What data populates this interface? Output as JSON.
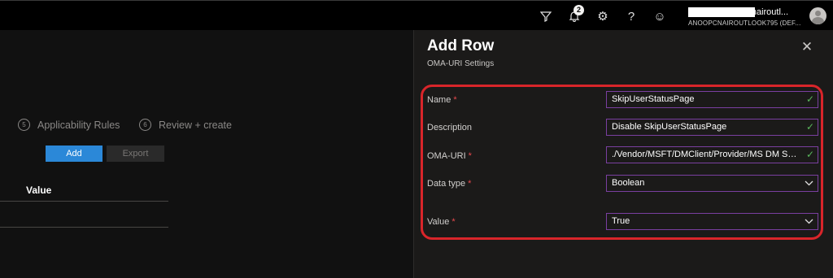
{
  "topbar": {
    "icons": [
      "filter-icon",
      "bell-icon",
      "gear-icon",
      "help-icon",
      "smiley-icon"
    ],
    "notification_count": "2",
    "user_email": "anoop@anoopcnairoutl...",
    "user_tenant": "ANOOPCNAIROUTLOOK795 (DEF..."
  },
  "wizard": {
    "steps": [
      {
        "number": "5",
        "label": "Applicability Rules"
      },
      {
        "number": "6",
        "label": "Review + create"
      }
    ],
    "add_label": "Add",
    "export_label": "Export",
    "column_header": "Value"
  },
  "panel": {
    "title": "Add Row",
    "subtitle": "OMA-URI Settings",
    "fields": [
      {
        "label": "Name",
        "required": true,
        "value": "SkipUserStatusPage",
        "state": "valid"
      },
      {
        "label": "Description",
        "required": false,
        "value": "Disable SkipUserStatusPage",
        "state": "valid"
      },
      {
        "label": "OMA-URI",
        "required": true,
        "value": "./Vendor/MSFT/DMClient/Provider/MS DM Server/FirstSyncStatus/SkipUserStatusPage",
        "state": "valid"
      },
      {
        "label": "Data type",
        "required": true,
        "value": "Boolean",
        "state": "dropdown"
      },
      {
        "label": "Value",
        "required": true,
        "value": "True",
        "state": "dropdown"
      }
    ],
    "required_marker": "*"
  },
  "colors": {
    "highlight": "#d9252a",
    "primary_button": "#2b88d8",
    "field_border": "#7a3fa0",
    "valid_check": "#5bb85d"
  }
}
